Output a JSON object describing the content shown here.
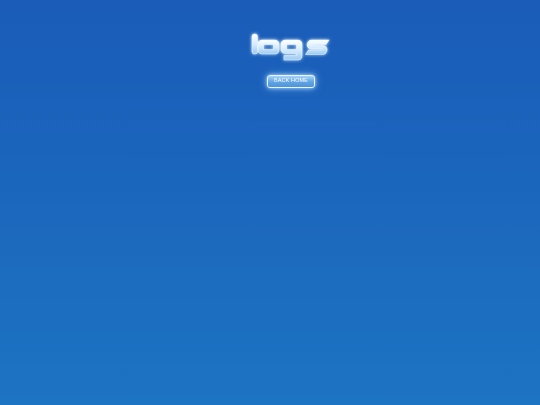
{
  "logo": {
    "text": "logs",
    "icon": "logs-logo-icon"
  },
  "nav": {
    "back_home_label": "BACK HOME"
  },
  "colors": {
    "background_top": "#1a5cb8",
    "background_bottom": "#1d74c2",
    "logo_fill": "#cfe8ff",
    "button_fill": "#5fa3e2"
  }
}
